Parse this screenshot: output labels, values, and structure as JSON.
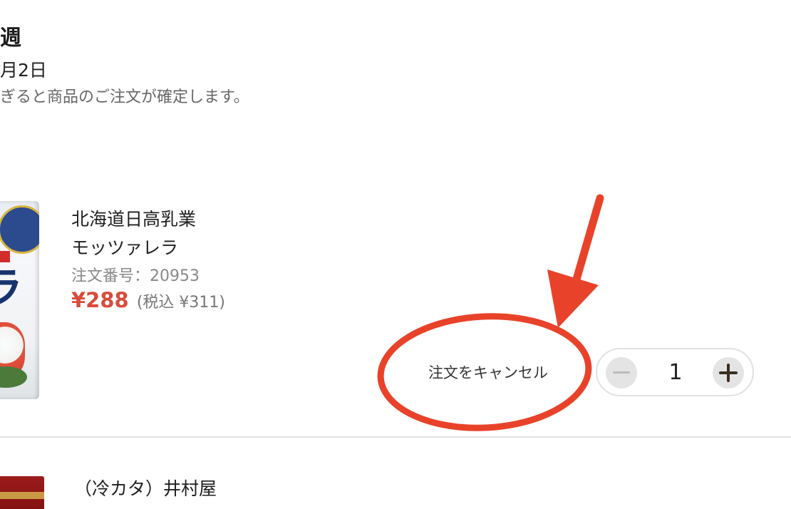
{
  "header": {
    "week_title": "週",
    "delivery_date": "月2日",
    "notice": "ぎると商品のご注文が確定します。"
  },
  "items": [
    {
      "brand": "北海道日高乳業",
      "name": "モッツァレラ",
      "order_number": "注文番号：20953",
      "price": "¥288",
      "tax_included": "(税込 ¥311)",
      "image_label": "ラ",
      "cancel_label": "注文をキャンセル",
      "quantity": "1",
      "minus_symbol": "−",
      "plus_symbol": "+"
    },
    {
      "name": "（冷カタ）井村屋"
    }
  ],
  "annotation": {
    "color": "#e8432a",
    "shapes": [
      "ellipse",
      "arrow"
    ]
  },
  "colors": {
    "price": "#d94b3b",
    "divider": "#e2e2e2",
    "stepper_button": "#e4e4e4"
  }
}
